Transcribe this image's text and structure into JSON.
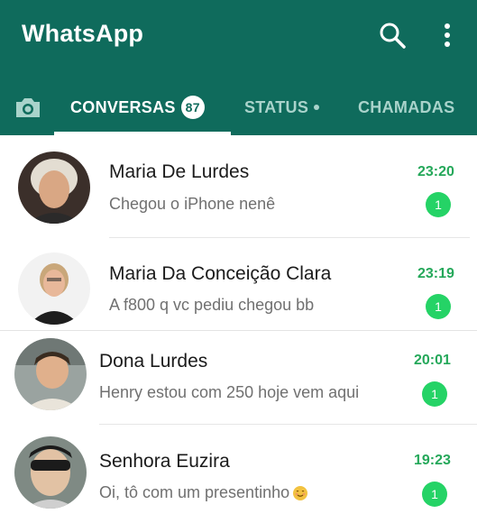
{
  "app": {
    "title": "WhatsApp"
  },
  "colors": {
    "header": "#0f6b5c",
    "accent": "#25d366",
    "time": "#25a85a"
  },
  "toolbar": {
    "search_icon": "search-icon",
    "menu_icon": "more-vertical-icon"
  },
  "tabs": [
    {
      "id": "camera",
      "icon": "camera-icon"
    },
    {
      "id": "chats",
      "label": "CONVERSAS",
      "badge": "87",
      "active": true
    },
    {
      "id": "status",
      "label": "STATUS"
    },
    {
      "id": "calls",
      "label": "CHAMADAS"
    }
  ],
  "chats": [
    {
      "name": "Maria De Lurdes",
      "message": "Chegou o iPhone nenê",
      "time": "23:20",
      "unread": "1"
    },
    {
      "name": "Maria Da Conceição Clara",
      "message": "A f800 q vc pediu chegou bb",
      "time": "23:19",
      "unread": "1"
    },
    {
      "name": "Dona Lurdes",
      "message": "Henry estou com 250 hoje vem aqui",
      "time": "20:01",
      "unread": "1"
    },
    {
      "name": "Senhora Euzira",
      "message": "Oi, tô com um presentinho",
      "time": "19:23",
      "unread": "1"
    }
  ]
}
